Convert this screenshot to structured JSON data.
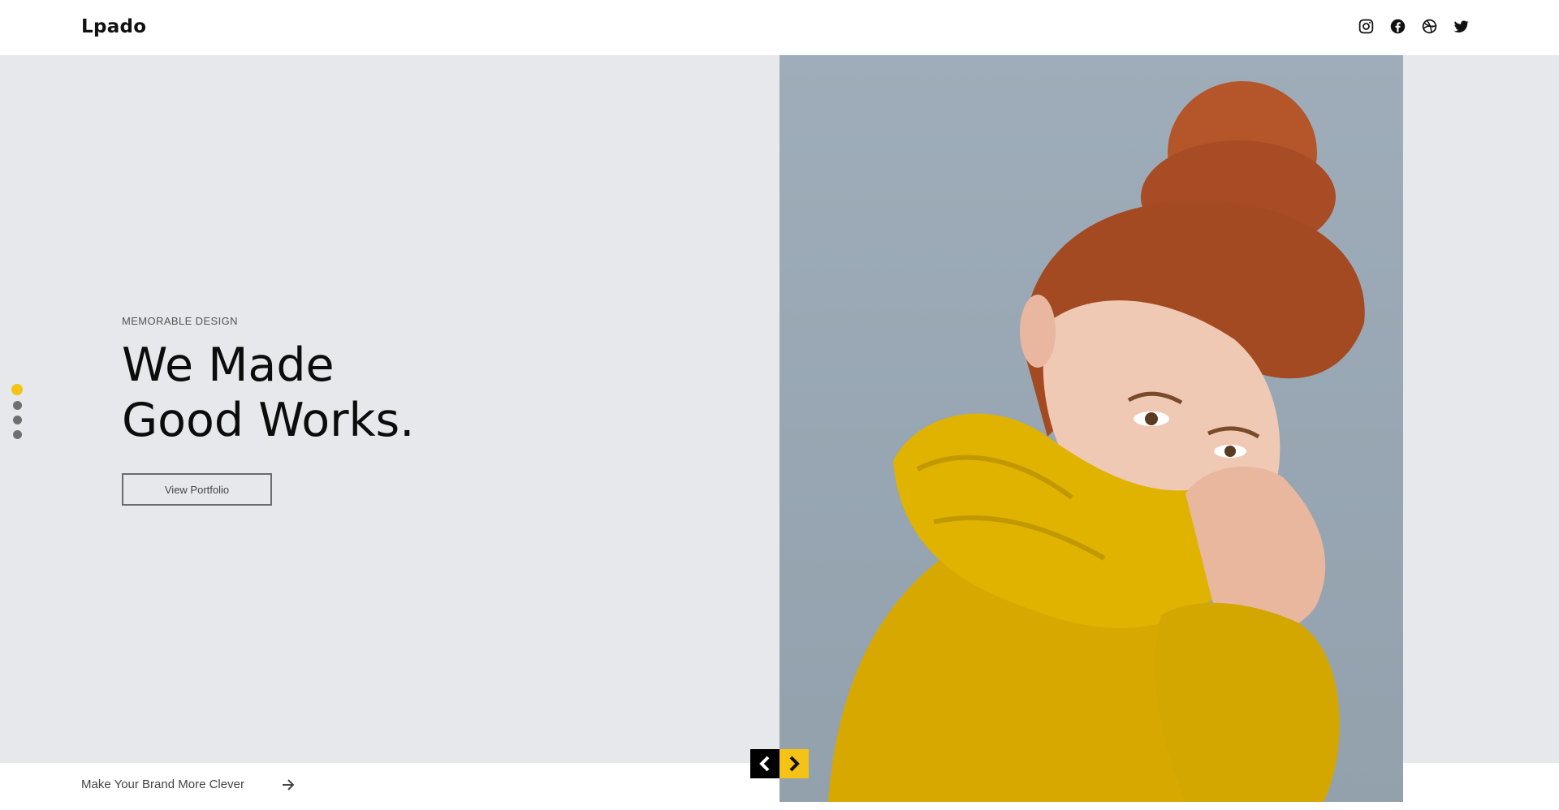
{
  "brand": {
    "logo": "Lpado"
  },
  "socials": [
    {
      "name": "instagram-icon"
    },
    {
      "name": "facebook-icon"
    },
    {
      "name": "dribbble-icon"
    },
    {
      "name": "twitter-icon"
    }
  ],
  "hero": {
    "eyebrow": "MEMORABLE DESIGN",
    "headline_line1": "We Made",
    "headline_line2": "Good Works.",
    "cta_label": "View Portfolio",
    "slider": {
      "total": 4,
      "active": 1
    }
  },
  "footer": {
    "tagline": "Make Your Brand More Clever"
  },
  "colors": {
    "accent": "#f4c316",
    "hero_bg": "#e7e8ec",
    "text_dark": "#0c0c0c"
  },
  "icons": {
    "prev": "chevron-left-icon",
    "next": "chevron-right-icon",
    "footer_arrow": "arrow-right-icon"
  }
}
